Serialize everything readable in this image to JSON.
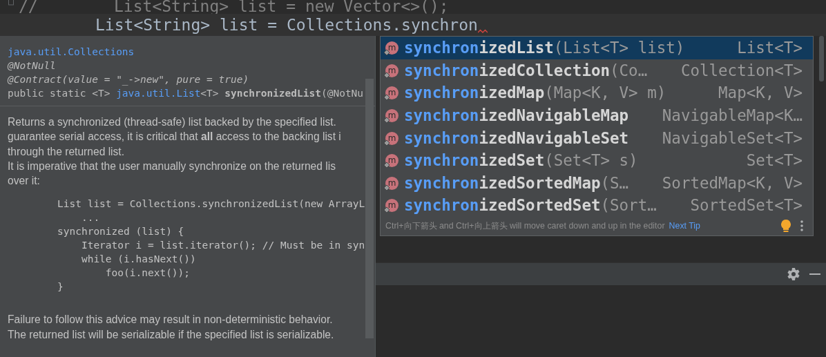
{
  "editor": {
    "lines": [
      {
        "kind": "comment",
        "mark": "//",
        "text": "List<String> list = new Vector<>();"
      },
      {
        "kind": "code",
        "text": "List<String> list = Collections.synchron",
        "current": true,
        "error": true
      }
    ]
  },
  "documentation": {
    "header": [
      {
        "kind": "link",
        "text": "java.util.Collections"
      },
      {
        "kind": "annotation",
        "text": "@NotNull"
      },
      {
        "kind": "annotation",
        "text": "@Contract(value = \"_->new\", pure = true)"
      },
      {
        "kind": "signature",
        "parts": [
          {
            "kind": "plain",
            "text": "public static <T> "
          },
          {
            "kind": "link",
            "text": "java.util.List"
          },
          {
            "kind": "plain",
            "text": "<T> "
          },
          {
            "kind": "bold",
            "text": "synchronizedList"
          },
          {
            "kind": "plain",
            "text": "(@NotNu"
          }
        ]
      }
    ],
    "description": [
      "Returns a synchronized (thread-safe) list backed by the specified list.",
      "guarantee serial access, it is critical that **all** access to the backing list i",
      "through the returned list.",
      "It is imperative that the user manually synchronize on the returned lis",
      "over it:"
    ],
    "code": [
      "List list = Collections.synchronizedList(new ArrayL",
      "    ...",
      "synchronized (list) {",
      "    Iterator i = list.iterator(); // Must be in syn",
      "    while (i.hasNext())",
      "        foo(i.next());",
      "}"
    ],
    "footer": [
      "Failure to follow this advice may result in non-deterministic behavior.",
      "The returned list will be serializable if the specified list is serializable."
    ]
  },
  "completion": {
    "items": [
      {
        "icon": "m",
        "match": "synchron",
        "rest": "izedList",
        "params": "(List<T> list)",
        "type": "List<T>",
        "selected": true
      },
      {
        "icon": "m",
        "match": "synchron",
        "rest": "izedCollection",
        "params": "(Co…",
        "type": "Collection<T>",
        "selected": false
      },
      {
        "icon": "m",
        "match": "synchron",
        "rest": "izedMap",
        "params": "(Map<K, V> m)",
        "type": "Map<K, V>",
        "selected": false
      },
      {
        "icon": "m",
        "match": "synchron",
        "rest": "izedNavigableMap",
        "type": "NavigableMap<K…",
        "selected": false
      },
      {
        "icon": "m",
        "match": "synchron",
        "rest": "izedNavigableSet",
        "type": "NavigableSet<T>",
        "selected": false
      },
      {
        "icon": "m",
        "match": "synchron",
        "rest": "izedSet",
        "params": "(Set<T> s)",
        "type": "Set<T>",
        "selected": false
      },
      {
        "icon": "m",
        "match": "synchron",
        "rest": "izedSortedMap",
        "params": "(S…",
        "type": "SortedMap<K, V>",
        "selected": false
      },
      {
        "icon": "m",
        "match": "synchron",
        "rest": "izedSortedSet",
        "params": "(Sort…",
        "type": "SortedSet<T>",
        "selected": false
      }
    ],
    "tip": "Ctrl+向下箭头 and Ctrl+向上箭头 will move caret down and up in the editor",
    "tip_link": "Next Tip"
  }
}
